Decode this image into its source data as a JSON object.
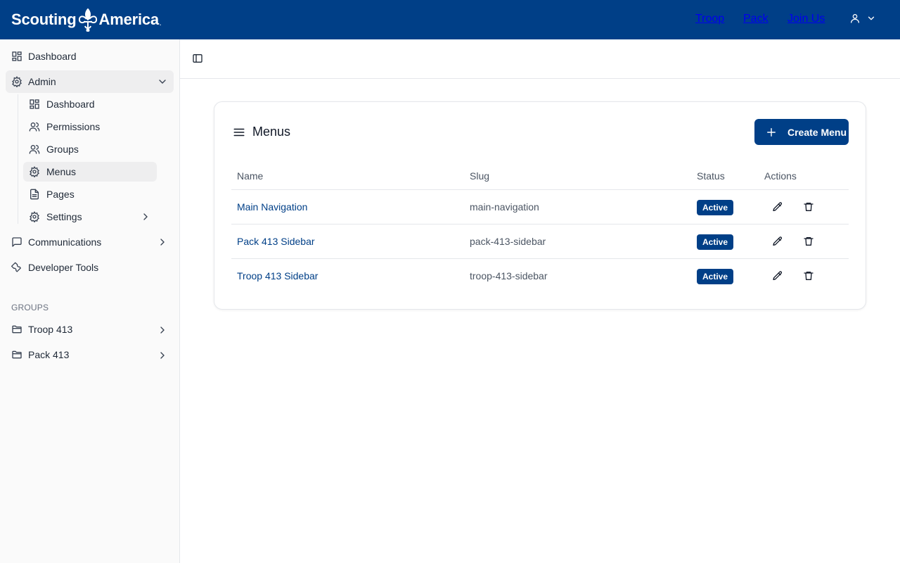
{
  "brand": {
    "left": "Scouting",
    "right": "America",
    "mark": "."
  },
  "topnav": [
    {
      "label": "Troop"
    },
    {
      "label": "Pack"
    },
    {
      "label": "Join Us"
    }
  ],
  "sidebar": {
    "items": [
      {
        "label": "Dashboard",
        "icon": "dashboard-icon"
      },
      {
        "label": "Admin",
        "icon": "gear-icon",
        "expanded": true
      },
      {
        "label": "Communications",
        "icon": "message-icon"
      },
      {
        "label": "Developer Tools",
        "icon": "wrench-icon"
      }
    ],
    "admin_children": [
      {
        "label": "Dashboard",
        "icon": "dashboard-icon"
      },
      {
        "label": "Permissions",
        "icon": "users-icon"
      },
      {
        "label": "Groups",
        "icon": "users-icon"
      },
      {
        "label": "Menus",
        "icon": "gear-icon",
        "active": true
      },
      {
        "label": "Pages",
        "icon": "file-icon"
      },
      {
        "label": "Settings",
        "icon": "gear-icon"
      }
    ],
    "groups_label": "GROUPS",
    "groups": [
      {
        "label": "Troop 413",
        "icon": "folder-icon"
      },
      {
        "label": "Pack 413",
        "icon": "folder-icon"
      }
    ]
  },
  "card": {
    "title": "Menus",
    "create_label": "Create Menu",
    "columns": [
      "Name",
      "Slug",
      "Status",
      "Actions"
    ],
    "rows": [
      {
        "name": "Main Navigation",
        "slug": "main-navigation",
        "status": "Active"
      },
      {
        "name": "Pack 413 Sidebar",
        "slug": "pack-413-sidebar",
        "status": "Active"
      },
      {
        "name": "Troop 413 Sidebar",
        "slug": "troop-413-sidebar",
        "status": "Active"
      }
    ]
  },
  "colors": {
    "brand": "#003f87",
    "sidebar_bg": "#fafafa",
    "active_bg": "#eeeeef",
    "border": "#e5e7eb"
  }
}
